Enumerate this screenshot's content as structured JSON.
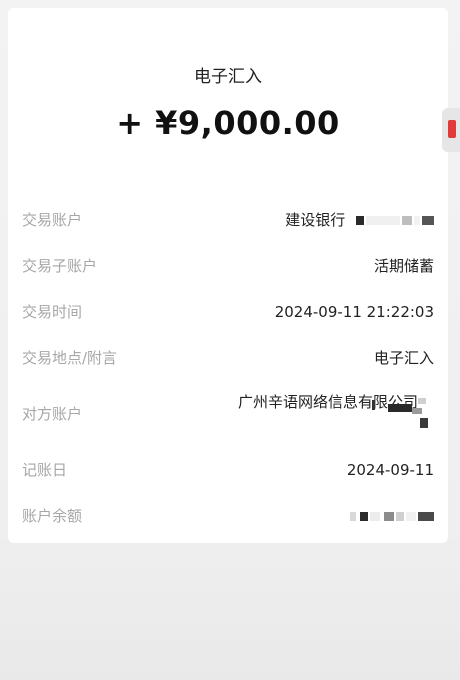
{
  "header": {
    "type": "电子汇入",
    "amount": "+ ¥9,000.00"
  },
  "details": [
    {
      "label": "交易账户",
      "value": "建设银行"
    },
    {
      "label": "交易子账户",
      "value": "活期储蓄"
    },
    {
      "label": "交易时间",
      "value": "2024-09-11 21:22:03"
    },
    {
      "label": "交易地点/附言",
      "value": "电子汇入"
    },
    {
      "label": "对方账户",
      "value": "广州辛语网络信息有限公司"
    },
    {
      "label": "记账日",
      "value": "2024-09-11"
    },
    {
      "label": "账户余额",
      "value": ""
    }
  ],
  "colors": {
    "label": "#a7a7a7",
    "value": "#222222",
    "accent": "#e03a3a"
  }
}
